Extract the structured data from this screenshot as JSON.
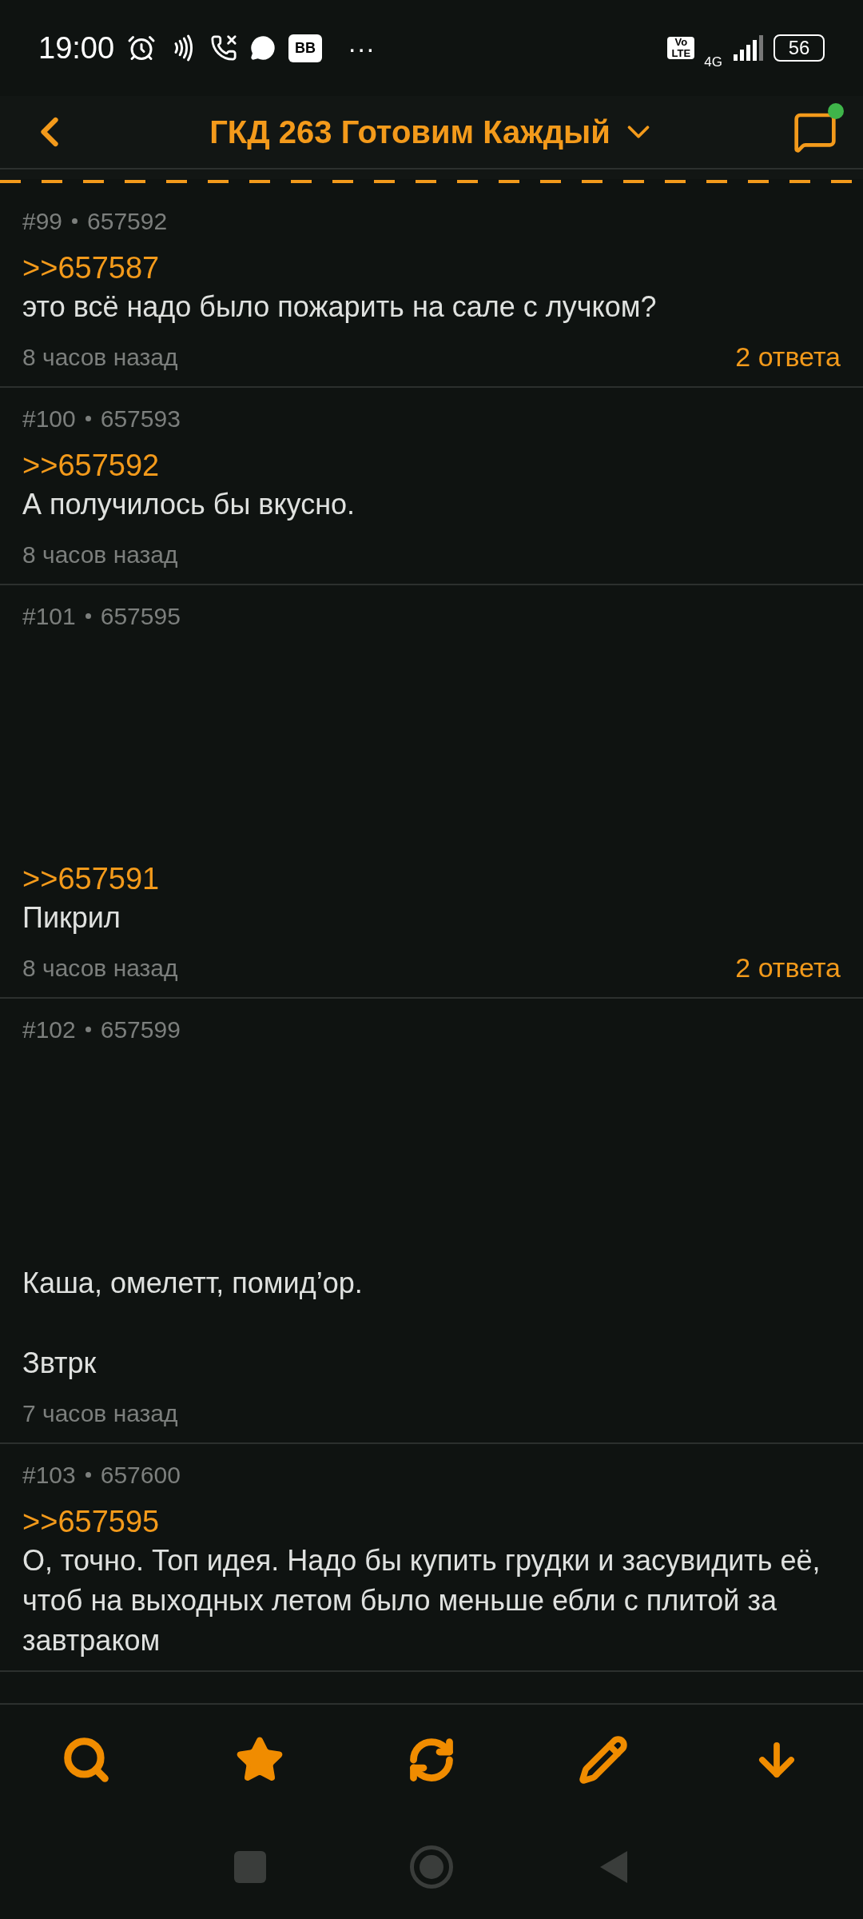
{
  "status_bar": {
    "time": "19:00",
    "volte": "Vo LTE",
    "network": "4G",
    "battery": "56",
    "badge": "BB",
    "more": "···"
  },
  "header": {
    "title": "ГКД 263 Готовим Каждый",
    "unread": true
  },
  "posts": [
    {
      "kind": "text",
      "number": "#99",
      "id": "657592",
      "reply_to": ">>657587",
      "body": "это всё надо было пожарить на сале с лучком?",
      "time": "8 часов назад",
      "replies": "2 ответа"
    },
    {
      "kind": "text",
      "number": "#100",
      "id": "657593",
      "reply_to": ">>657592",
      "body": "А получилось бы вкусно.",
      "time": "8 часов назад"
    },
    {
      "kind": "media",
      "number": "#101",
      "id": "657595",
      "reply_to": ">>657591",
      "body": "Пикрил",
      "time": "8 часов назад",
      "replies": "2 ответа"
    },
    {
      "kind": "media",
      "number": "#102",
      "id": "657599",
      "body": "Каша, омелетт, помид’ор.\n\nЗвтрк",
      "time": "7 часов назад"
    },
    {
      "kind": "text",
      "number": "#103",
      "id": "657600",
      "reply_to": ">>657595",
      "body": "О, точно. Топ идея. Надо бы купить грудки и засувидить её, чтоб на выходных летом было меньше ебли с плитой за завтраком"
    }
  ]
}
